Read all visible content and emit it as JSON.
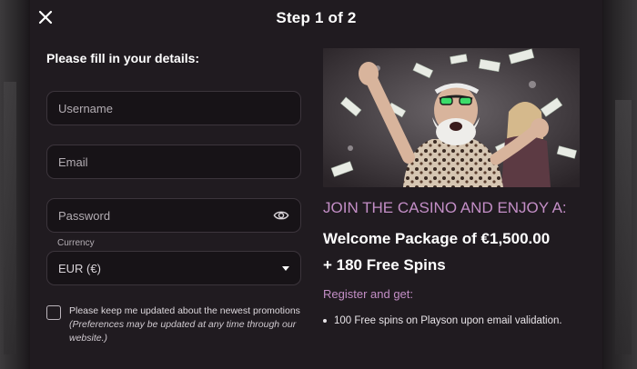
{
  "modal": {
    "title": "Step 1 of 2",
    "close_icon": "close-icon"
  },
  "form": {
    "heading": "Please fill in your details:",
    "username": {
      "placeholder": "Username",
      "value": ""
    },
    "email": {
      "placeholder": "Email",
      "value": ""
    },
    "password": {
      "placeholder": "Password",
      "value": "",
      "toggle_icon": "eye-icon"
    },
    "currency": {
      "label": "Currency",
      "value": "EUR (€)",
      "icon": "caret-down-icon"
    },
    "consent": {
      "checked": false,
      "label": "Please keep me updated about the newest promotions",
      "note": "(Preferences may be updated at any time through our website.)"
    }
  },
  "promo": {
    "image": "promo-image",
    "tagline": "JOIN THE CASINO AND ENJOY A:",
    "offer_line1": "Welcome Package of €1,500.00",
    "offer_line2": "+ 180 Free Spins",
    "subheading": "Register and get:",
    "bullets": [
      "100 Free spins on Playson upon email validation."
    ]
  },
  "colors": {
    "background": "#201b20",
    "input_bg": "#171317",
    "accent": "#c38ec6",
    "text": "#ffffff"
  }
}
